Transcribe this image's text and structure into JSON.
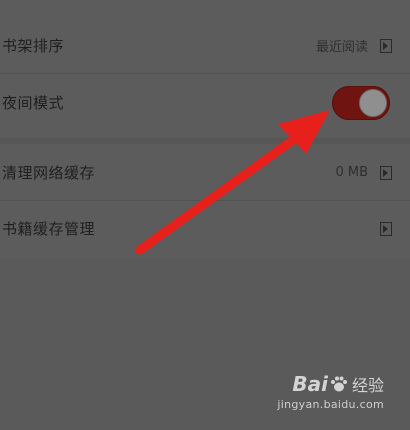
{
  "settings": {
    "rows": [
      {
        "label": "书架排序",
        "value": "最近阅读"
      },
      {
        "label": "夜间模式",
        "toggle_on": true
      },
      {
        "label": "清理网络缓存",
        "value": "0 MB"
      },
      {
        "label": "书籍缓存管理",
        "value": ""
      }
    ]
  },
  "colors": {
    "background": "#5a5a5a",
    "toggle_track": "#6f1410",
    "annotation_arrow": "#e8201c"
  },
  "watermark": {
    "brand_left": "Bai",
    "brand_right": "经验",
    "url": "jingyan.baidu.com"
  }
}
